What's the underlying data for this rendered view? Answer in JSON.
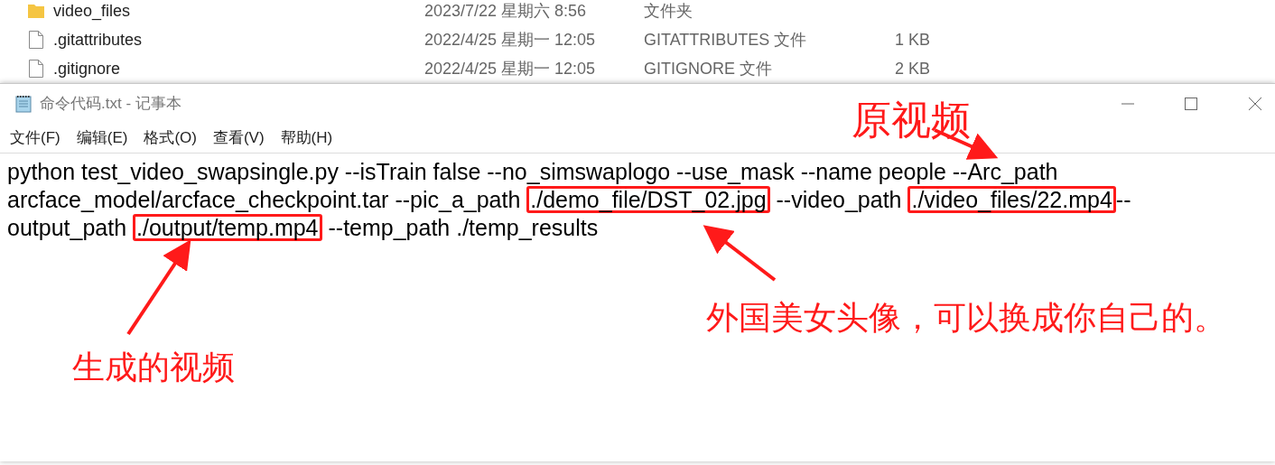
{
  "explorer_rows": [
    {
      "kind": "folder",
      "name": "video_files",
      "date": "2023/7/22 星期六 8:56",
      "type": "文件夹"
    },
    {
      "kind": "file",
      "name": ".gitattributes",
      "date": "2022/4/25 星期一 12:05",
      "type": "GITATTRIBUTES 文件",
      "size": "1 KB"
    },
    {
      "kind": "file",
      "name": ".gitignore",
      "date": "2022/4/25 星期一 12:05",
      "type": "GITIGNORE 文件",
      "size": "2 KB"
    }
  ],
  "window": {
    "title": "命令代码.txt - 记事本"
  },
  "menu": [
    "文件(F)",
    "编辑(E)",
    "格式(O)",
    "查看(V)",
    "帮助(H)"
  ],
  "lines": [
    [
      {
        "text": "python test_video_swapsingle.py --isTrain false --no_simswaplogo --use_mask --name people --Arc_path",
        "boxed": false
      }
    ],
    [
      {
        "text": "arcface_model/arcface_checkpoint.tar --pic_a_path ",
        "boxed": false
      },
      {
        "text": "./demo_file/DST_02.jpg",
        "boxed": true
      },
      {
        "text": " --video_path ",
        "boxed": false
      },
      {
        "text": "./video_files/22.mp4",
        "boxed": true
      },
      {
        "text": "--",
        "boxed": false
      }
    ],
    [
      {
        "text": "output_path ",
        "boxed": false
      },
      {
        "text": "./output/temp.mp4",
        "boxed": true
      },
      {
        "text": " --temp_path ./temp_results",
        "boxed": false
      }
    ]
  ],
  "annotations": [
    "原视频",
    "外国美女头像，可以换成你自己的。",
    "生成的视频"
  ]
}
